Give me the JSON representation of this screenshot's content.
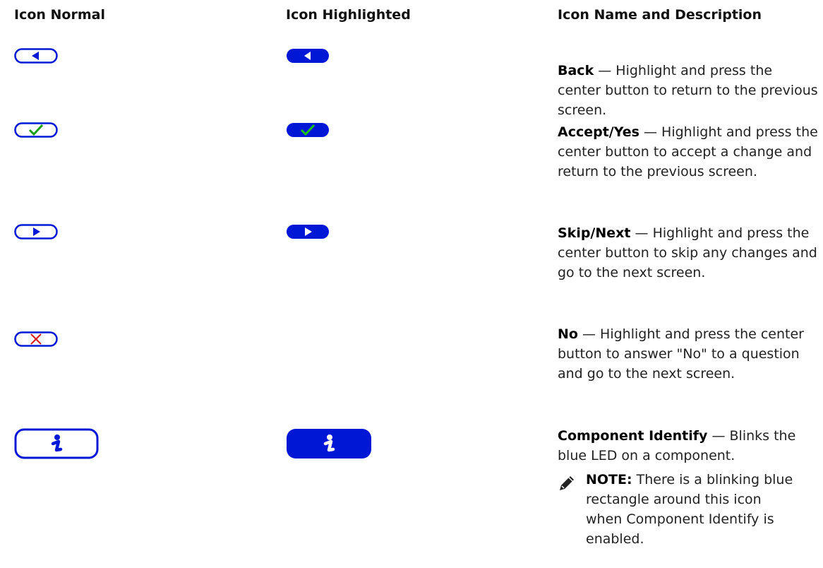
{
  "headers": {
    "normal": "Icon Normal",
    "highlighted": "Icon Highlighted",
    "description": "Icon Name and Description"
  },
  "rows": [
    {
      "icon": "back-arrow-icon",
      "name": "Back",
      "text": " — Highlight and press the center button to return to the previous screen."
    },
    {
      "icon": "checkmark-icon",
      "name": "Accept/Yes",
      "text": " — Highlight and press the center button to accept a change and return to the previous screen."
    },
    {
      "icon": "next-arrow-icon",
      "name": "Skip/Next",
      "text": " — Highlight and press the center button to skip any changes and go to the next screen."
    },
    {
      "icon": "x-icon",
      "name": "No",
      "text": " — Highlight and press the center button to answer \"No\" to a question and go to the next screen."
    },
    {
      "icon": "info-icon",
      "name": "Component Identify",
      "text": " — Blinks the blue LED on a component."
    }
  ],
  "note": {
    "label": "NOTE:",
    "text": " There is a blinking blue rectangle around this icon when Component Identify is enabled."
  },
  "colors": {
    "icon_blue": "#0018d6",
    "check_green": "#19c219",
    "x_red": "#d81b1b"
  }
}
